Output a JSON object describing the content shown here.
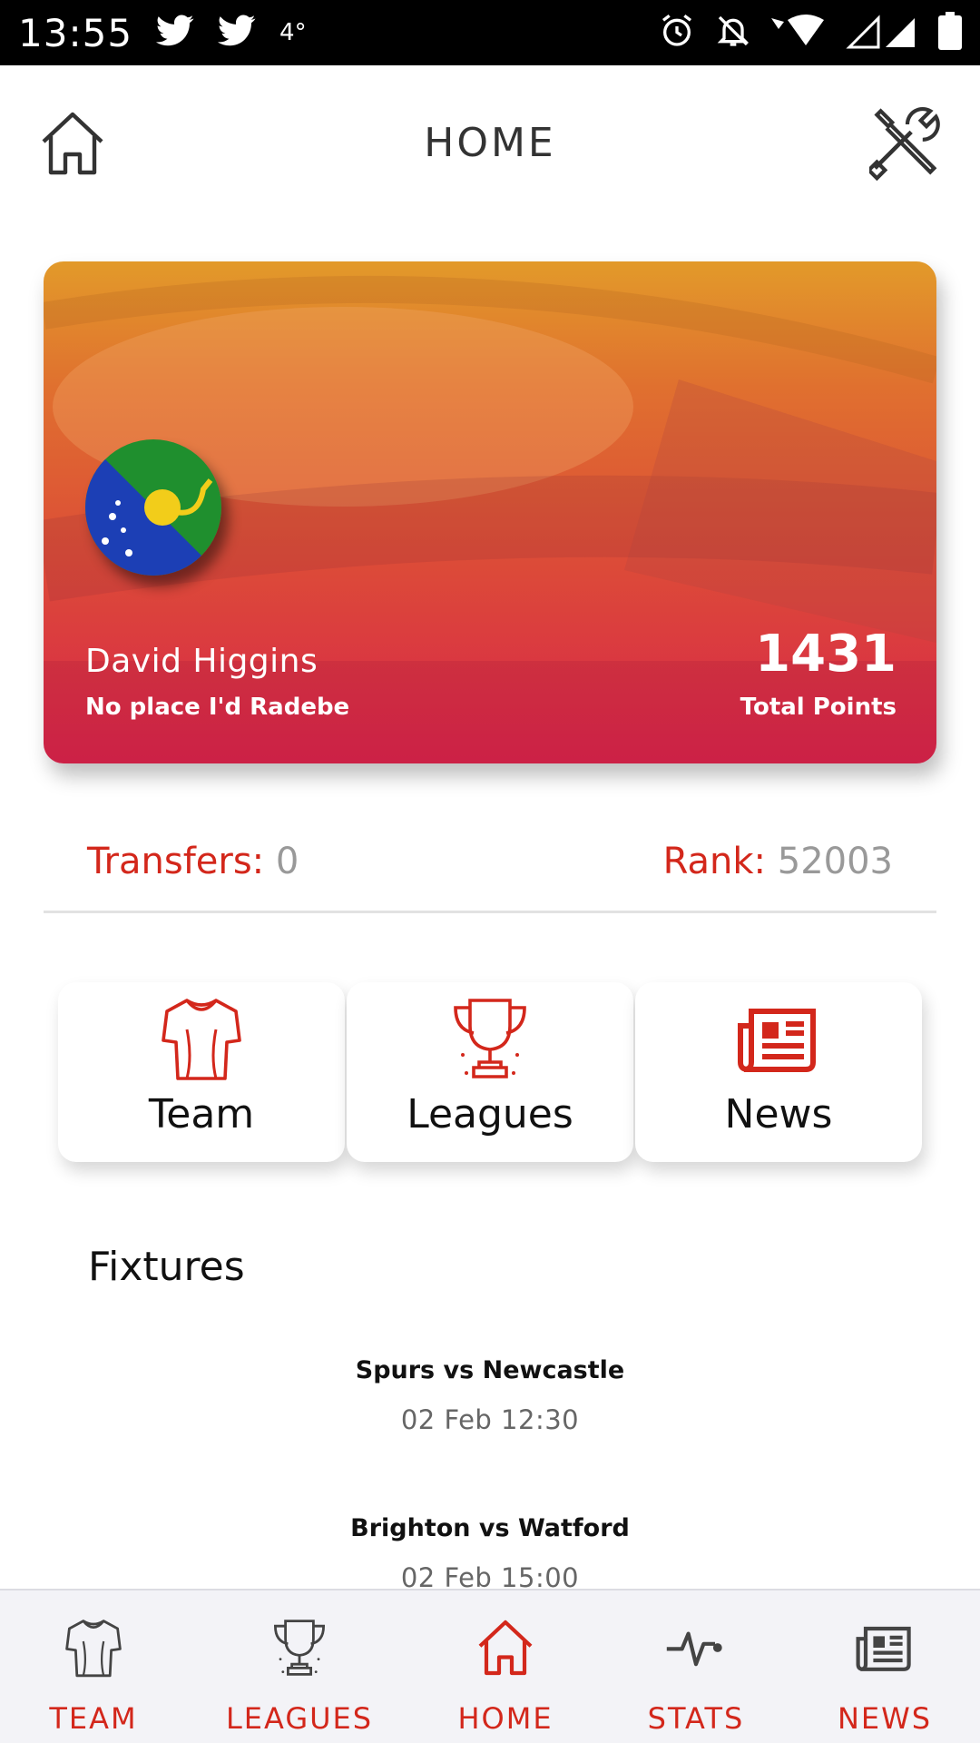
{
  "status_bar": {
    "time": "13:55",
    "temperature": "4°",
    "icons": [
      "twitter-icon",
      "twitter-icon",
      "alarm-icon",
      "notifications-off-icon",
      "wifi-icon",
      "signal-icon",
      "battery-icon"
    ]
  },
  "header": {
    "title": "HOME",
    "left_icon": "home-icon",
    "right_icon": "tools-icon"
  },
  "profile": {
    "name": "David Higgins",
    "team_name": "No place I'd Radebe",
    "points": "1431",
    "points_label": "Total Points",
    "avatar": "christmas-island-flag"
  },
  "stats": {
    "transfers_label": "Transfers:",
    "transfers_value": "0",
    "rank_label": "Rank:",
    "rank_value": "52003"
  },
  "tiles": [
    {
      "label": "Team",
      "icon": "jersey-icon"
    },
    {
      "label": "Leagues",
      "icon": "trophy-icon"
    },
    {
      "label": "News",
      "icon": "newspaper-icon"
    }
  ],
  "fixtures": {
    "title": "Fixtures",
    "items": [
      {
        "teams": "Spurs vs Newcastle",
        "date": "02 Feb 12:30"
      },
      {
        "teams": "Brighton vs Watford",
        "date": "02 Feb 15:00"
      }
    ]
  },
  "bottom_nav": [
    {
      "label": "TEAM",
      "icon": "jersey-icon"
    },
    {
      "label": "LEAGUES",
      "icon": "trophy-icon"
    },
    {
      "label": "HOME",
      "icon": "home-icon",
      "active": true
    },
    {
      "label": "STATS",
      "icon": "pulse-icon"
    },
    {
      "label": "NEWS",
      "icon": "newspaper-icon"
    }
  ],
  "colors": {
    "accent": "#d3271b",
    "card_gradient_top": "#e29a2a",
    "card_gradient_bottom": "#d9244a",
    "nav_background": "#f3f3f7"
  }
}
